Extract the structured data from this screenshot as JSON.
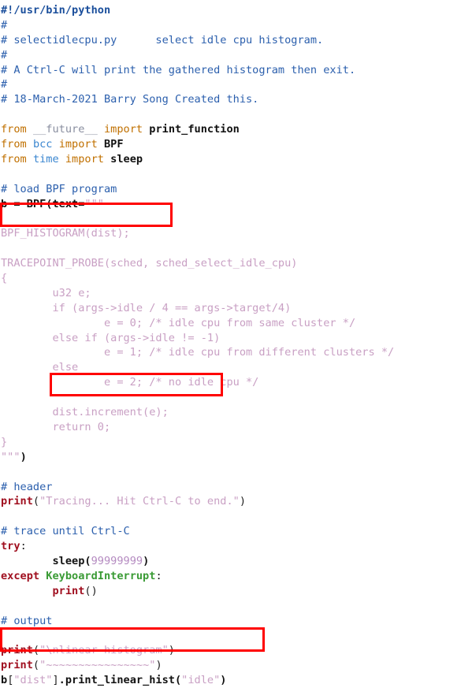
{
  "document": {
    "kind": "python-source-code",
    "filename": "selectidlecpu.py",
    "language": "Python",
    "background_color": "#ffffff",
    "highlight_box_color": "#ff0000"
  },
  "colors": {
    "comment": "#2b5fad",
    "keyword": "#c07000",
    "keyword_statement": "#a01020",
    "module": "#3a86d0",
    "identifier": "#111111",
    "string": "#c9a0c4",
    "number": "#b48ac0",
    "exception": "#3a9b35",
    "highlight": "#ff0000"
  },
  "code": {
    "lines": [
      "#!/usr/bin/python",
      "#",
      "# selectidlecpu.py      select idle cpu histogram.",
      "#",
      "# A Ctrl-C will print the gathered histogram then exit.",
      "#",
      "# 18-March-2021 Barry Song Created this.",
      "",
      "from __future__ import print_function",
      "from bcc import BPF",
      "from time import sleep",
      "",
      "# load BPF program",
      "b = BPF(text=\"\"\"",
      "",
      "BPF_HISTOGRAM(dist);",
      "",
      "TRACEPOINT_PROBE(sched, sched_select_idle_cpu)",
      "{",
      "        u32 e;",
      "        if (args->idle / 4 == args->target/4)",
      "                e = 0; /* idle cpu from same cluster */",
      "        else if (args->idle != -1)",
      "                e = 1; /* idle cpu from different clusters */",
      "        else",
      "                e = 2; /* no idle cpu */",
      "",
      "        dist.increment(e);",
      "        return 0;",
      "}",
      "\"\"\")",
      "",
      "# header",
      "print(\"Tracing... Hit Ctrl-C to end.\")",
      "",
      "# trace until Ctrl-C",
      "try:",
      "        sleep(99999999)",
      "except KeyboardInterrupt:",
      "        print()",
      "",
      "# output",
      "",
      "print(\"\\nlinear histogram\")",
      "print(\"~~~~~~~~~~~~~~~~\")",
      "b[\"dist\"].print_linear_hist(\"idle\")"
    ],
    "tokens": {
      "shebang": "#!/usr/bin/python",
      "comment_hash": "#",
      "comment_file_desc": "# selectidlecpu.py      select idle cpu histogram.",
      "comment_ctrlc": "# A Ctrl-C will print the gathered histogram then exit.",
      "comment_author": "# 18-March-2021 Barry Song Created this.",
      "kw_from": "from",
      "kw_import": "import",
      "mod_future": "__future__",
      "id_print_function": "print_function",
      "mod_bcc": "bcc",
      "id_BPF": "BPF",
      "mod_time": "time",
      "id_sleep": "sleep",
      "comment_load": "# load BPF program",
      "assign_b": "b = BPF(text=",
      "triple_quote_open": "\"\"\"",
      "c_bpf_histogram": "BPF_HISTOGRAM(dist);",
      "c_tracepoint": "TRACEPOINT_PROBE(sched, sched_select_idle_cpu)",
      "c_open_brace": "{",
      "c_u32": "        u32 e;",
      "c_if": "        if (args->idle / 4 == args->target/4)",
      "c_e0": "                e = 0; /* idle cpu from same cluster */",
      "c_elseif": "        else if (args->idle != -1)",
      "c_e1": "                e = 1; /* idle cpu from different clusters */",
      "c_else": "        else",
      "c_e2": "                e = 2; /* no idle cpu */",
      "c_increment": "        dist.increment(e);",
      "c_return": "        return 0;",
      "c_close_brace": "}",
      "triple_quote_close": "\"\"\"",
      "paren_close": ")",
      "comment_header": "# header",
      "kw_print": "print",
      "str_tracing": "\"Tracing... Hit Ctrl-C to end.\"",
      "comment_trace": "# trace until Ctrl-C",
      "kw_try": "try",
      "colon": ":",
      "call_sleep": "sleep(",
      "num_sleep": "99999999",
      "kw_except": "except",
      "exc_keyboardinterrupt": "KeyboardInterrupt",
      "comment_output": "# output",
      "str_linear_histogram": "\"\\nlinear histogram\"",
      "str_tildes": "\"~~~~~~~~~~~~~~~~\"",
      "last_b": "b",
      "last_bracket_open": "[",
      "str_dist": "\"dist\"",
      "last_bracket_close": "]",
      "last_method": ".print_linear_hist(",
      "str_idle": "\"idle\"",
      "last_paren_close": ")"
    }
  },
  "annotations": {
    "boxes": [
      {
        "name": "bpf-histogram",
        "label": "BPF_HISTOGRAM(dist);"
      },
      {
        "name": "dist-increment",
        "label": "dist.increment(e);"
      },
      {
        "name": "print-linear-hist",
        "label": "b[\"dist\"].print_linear_hist(\"idle\")"
      }
    ]
  }
}
